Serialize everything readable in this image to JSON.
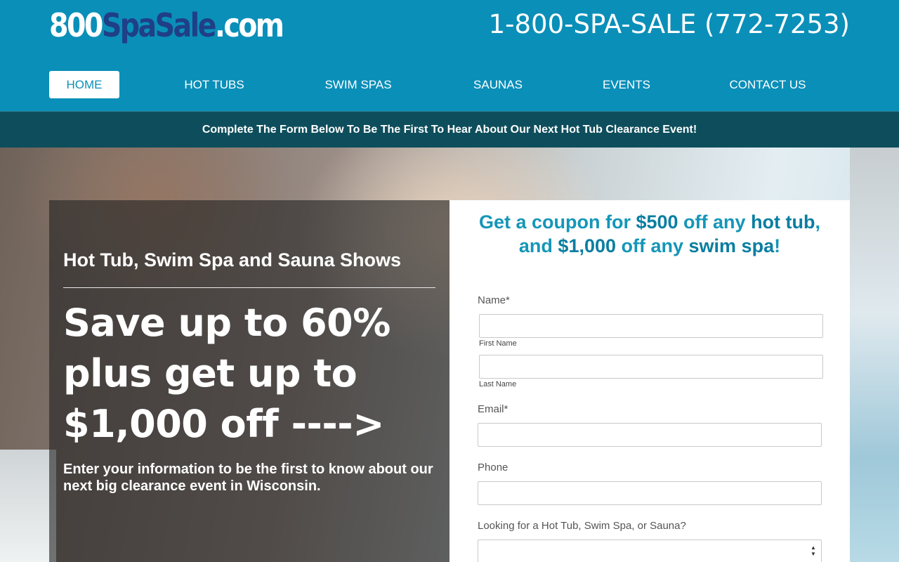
{
  "header": {
    "logo": {
      "part1": "800",
      "part2": "SpaSale",
      "part3": ".com"
    },
    "phone": "1-800-SPA-SALE (772-7253)"
  },
  "nav": {
    "items": [
      {
        "label": "HOME",
        "active": true
      },
      {
        "label": "HOT TUBS",
        "active": false
      },
      {
        "label": "SWIM SPAS",
        "active": false
      },
      {
        "label": "SAUNAS",
        "active": false
      },
      {
        "label": "EVENTS",
        "active": false
      },
      {
        "label": "CONTACT US",
        "active": false
      }
    ]
  },
  "announcement": "Complete The Form Below To Be The First To Hear About Our Next Hot Tub Clearance Event!",
  "hero": {
    "subheading": "Hot Tub, Swim Spa and Sauna Shows",
    "headline": "Save up to 60% plus get up to $1,000 off ---->",
    "body": "Enter your information to be the first to know about our next big clearance event in Wisconsin."
  },
  "form": {
    "title": {
      "t1": "Get a coupon for ",
      "t2": "$500",
      "t3": " off any ",
      "t4": "hot tub",
      "t5": ", and ",
      "t6": "$1,000",
      "t7": " off any ",
      "t8": "swim spa",
      "t9": "!"
    },
    "name_label": "Name*",
    "first_name_value": "",
    "first_name_sublabel": "First Name",
    "last_name_value": "",
    "last_name_sublabel": "Last Name",
    "email_label": "Email*",
    "email_value": "",
    "phone_label": "Phone",
    "phone_value": "",
    "interest_label": "Looking for a Hot Tub, Swim Spa, or Sauna?",
    "interest_selected": ""
  },
  "colors": {
    "header_bg": "#0a8fb9",
    "announce_bg": "#0e4e5c",
    "logo_accent": "#1f3f86",
    "form_title": "#1596b8"
  },
  "icons": {
    "select_arrows": "select-updown-icon"
  }
}
